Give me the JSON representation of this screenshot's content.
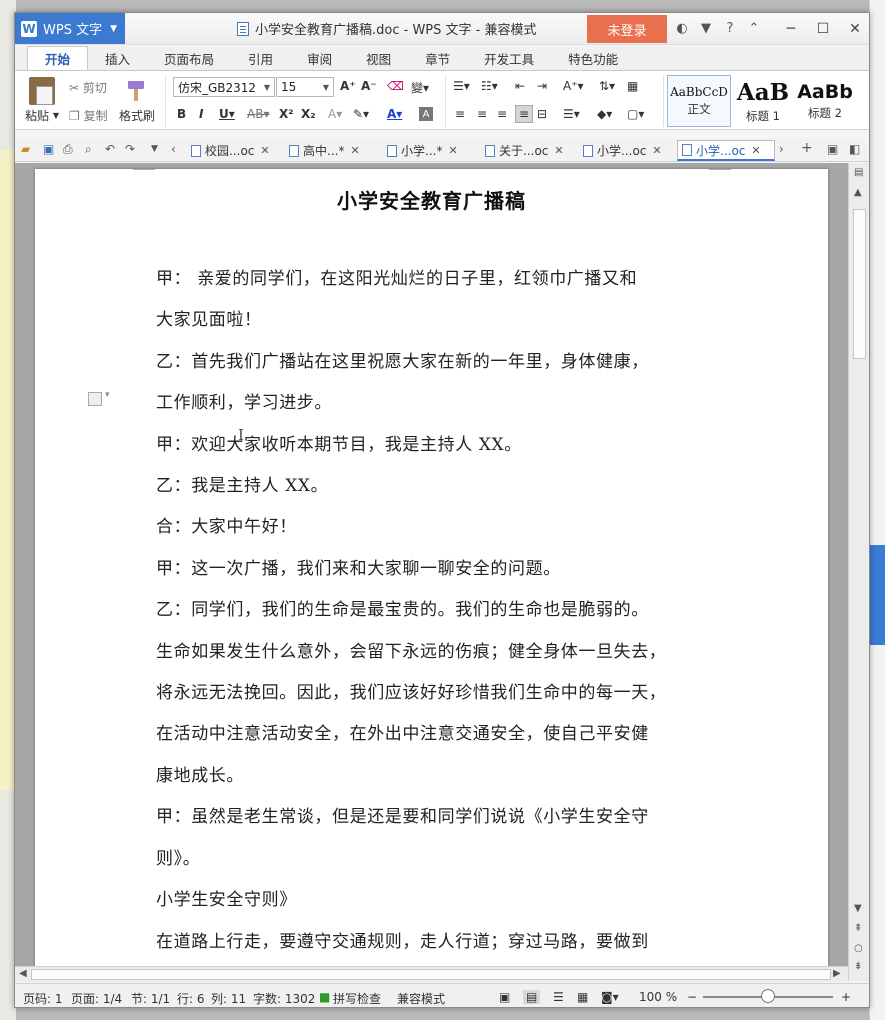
{
  "app": {
    "name": "WPS 文字",
    "window_title": "小学安全教育广播稿.doc - WPS 文字 - 兼容模式",
    "login_label": "未登录"
  },
  "ribbon_tabs": [
    "开始",
    "插入",
    "页面布局",
    "引用",
    "审阅",
    "视图",
    "章节",
    "开发工具",
    "特色功能"
  ],
  "ribbon": {
    "paste": "粘贴",
    "cut": "剪切",
    "copy": "复制",
    "format_painter": "格式刷",
    "font_name": "仿宋_GB2312",
    "font_size": "15",
    "styles": [
      {
        "sample": "AaBbCcD",
        "label": "正文"
      },
      {
        "sample": "AaB",
        "label": "标题 1"
      },
      {
        "sample": "AaBb",
        "label": "标题 2"
      }
    ]
  },
  "doc_tabs": [
    "校园...oc",
    "高中...*",
    "小学...*",
    "关于...oc",
    "小学...oc",
    "小学...oc"
  ],
  "document": {
    "title": "小学安全教育广播稿",
    "lines": [
      "甲： 亲爱的同学们，在这阳光灿烂的日子里，红领巾广播又和",
      "大家见面啦！",
      "乙：首先我们广播站在这里祝愿大家在新的一年里，身体健康，",
      "工作顺利，学习进步。",
      "甲：欢迎大家收听本期节目，我是主持人 XX。",
      "乙：我是主持人 XX。",
      "合：大家中午好！",
      "甲：这一次广播，我们来和大家聊一聊安全的问题。",
      "乙：同学们，我们的生命是最宝贵的。我们的生命也是脆弱的。",
      "生命如果发生什么意外，会留下永远的伤痕；健全身体一旦失去，",
      "将永远无法挽回。因此，我们应该好好珍惜我们生命中的每一天，",
      "在活动中注意活动安全，在外出中注意交通安全，使自己平安健",
      "康地成长。",
      "甲：虽然是老生常谈，但是还是要和同学们说说《小学生安全守",
      "则》。",
      "小学生安全守则》",
      "在道路上行走，要遵守交通规则，走人行道；穿过马路，要做到"
    ]
  },
  "status": {
    "page_no": "页码: 1",
    "pages": "页面: 1/4",
    "section": "节: 1/1",
    "row": "行: 6",
    "col": "列: 11",
    "words": "字数: 1302",
    "spell": "拼写检查",
    "mode": "兼容模式",
    "zoom": "100 %"
  },
  "colors": {
    "accent": "#3b7ad0",
    "login": "#e8704f"
  }
}
